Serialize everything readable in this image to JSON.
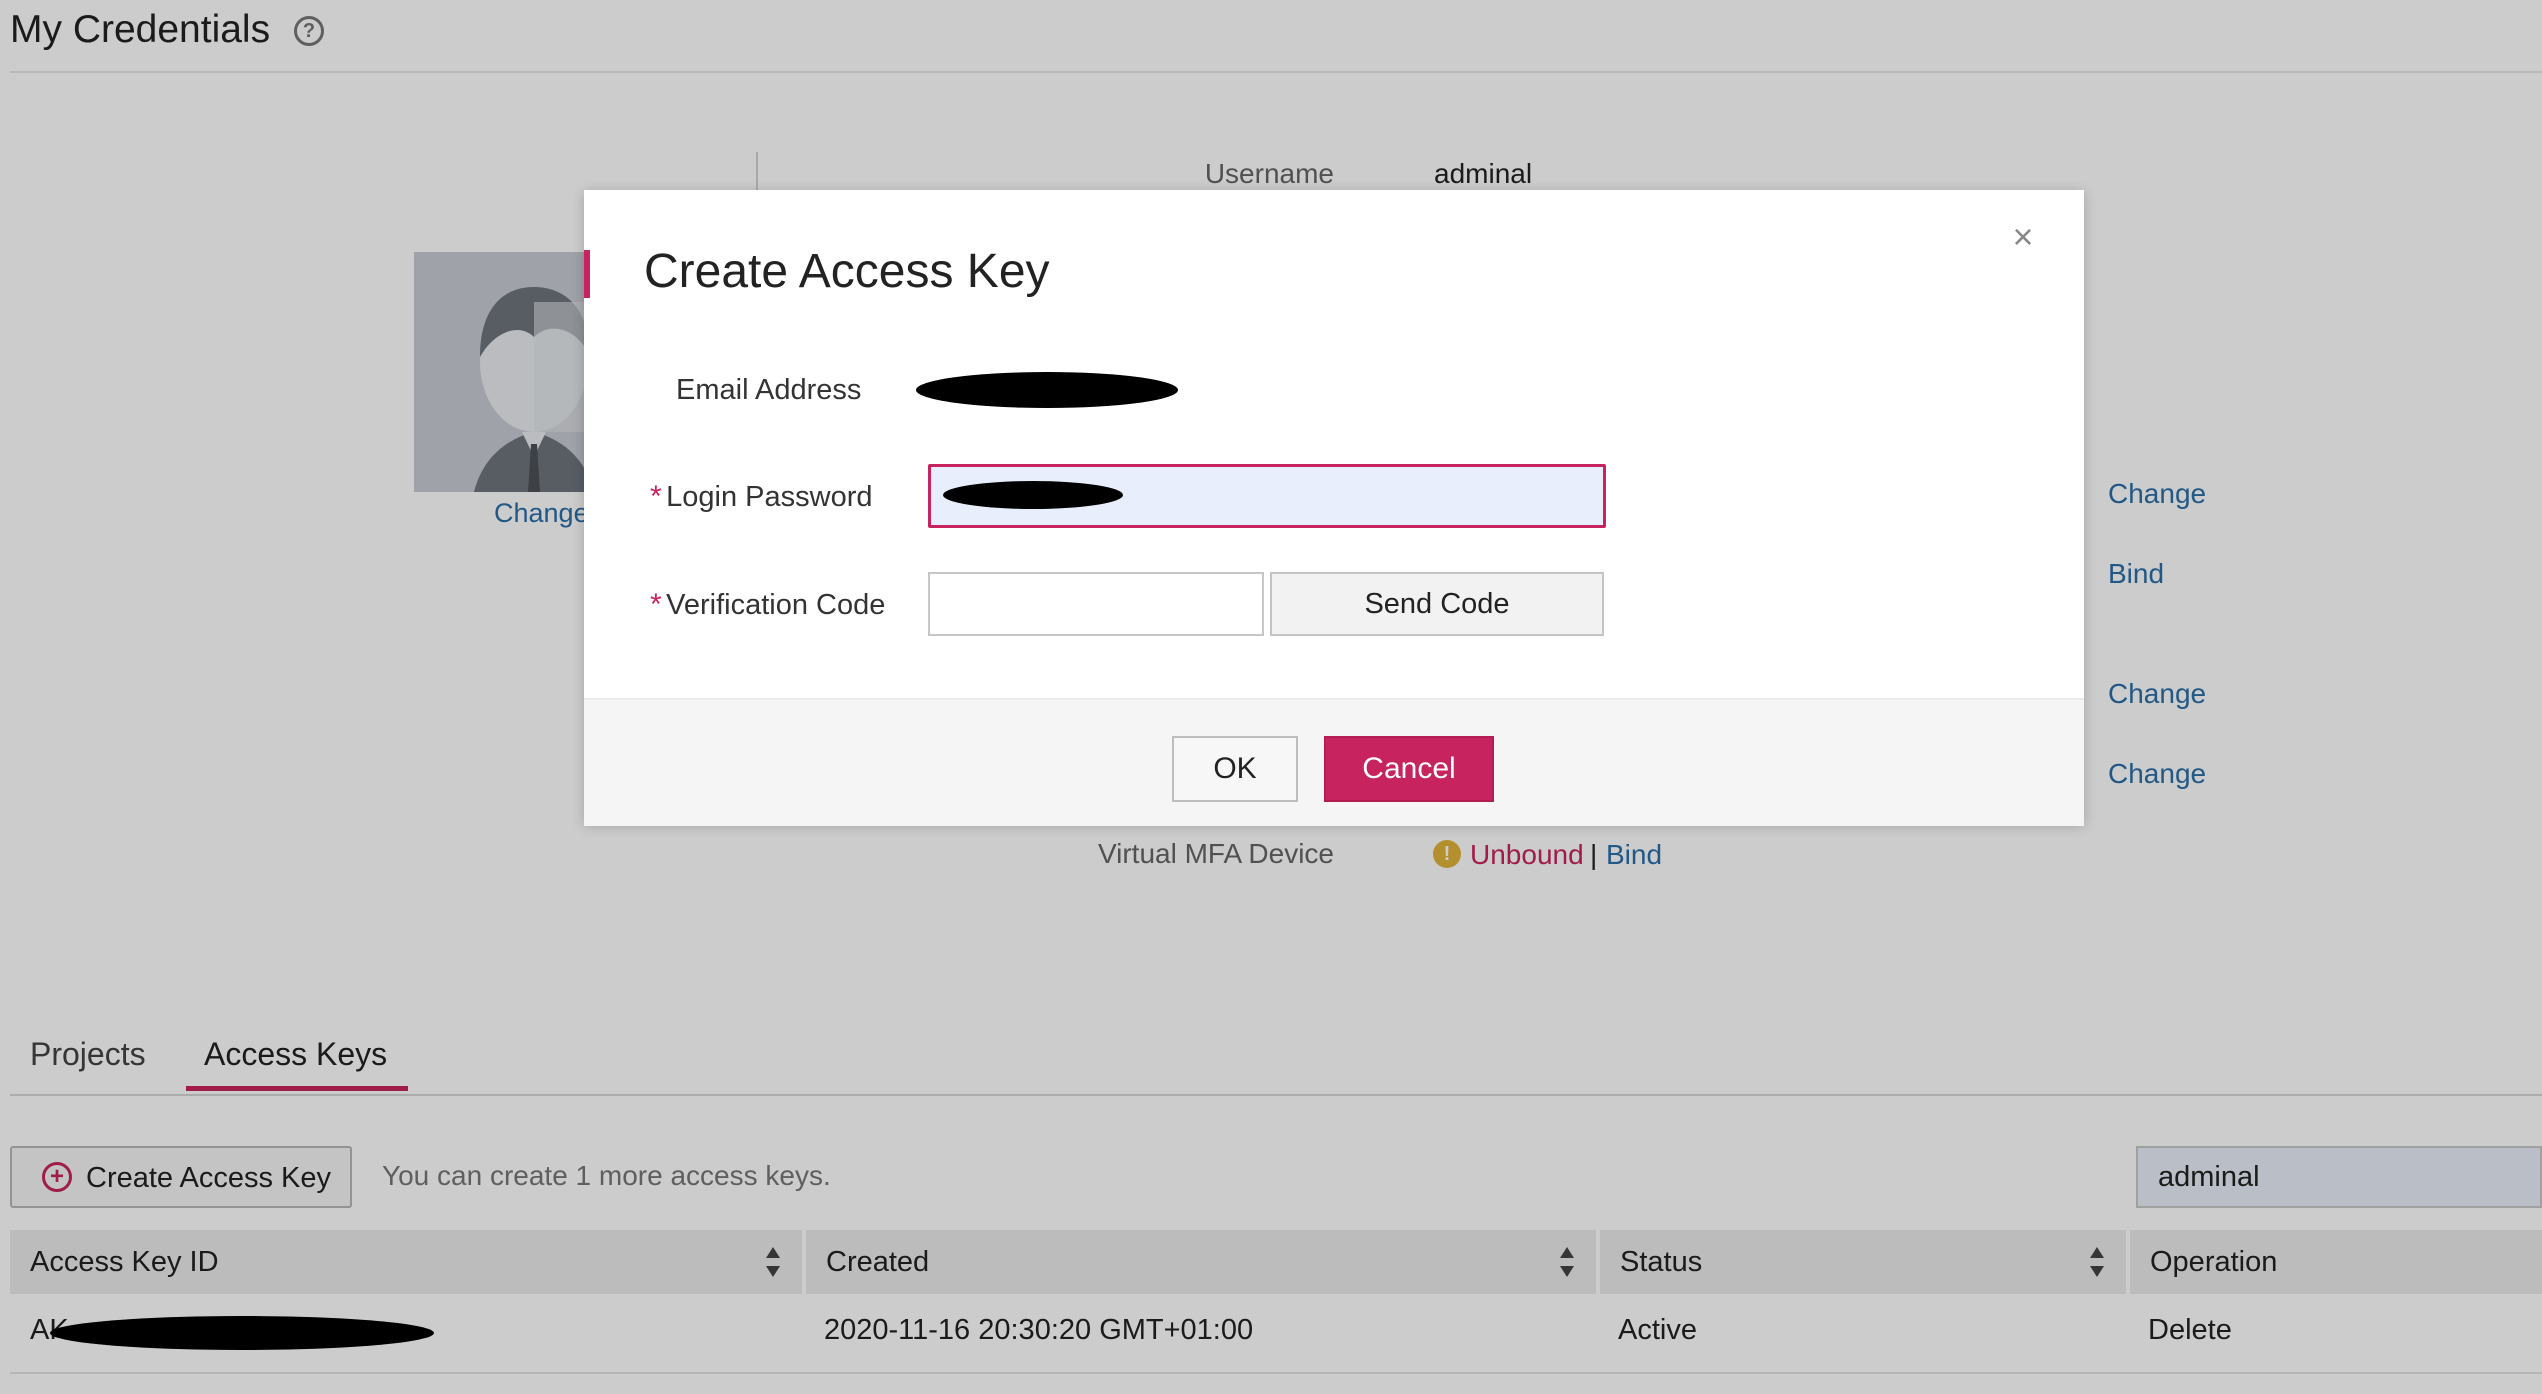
{
  "header": {
    "title": "My Credentials",
    "help_icon": "question-circle-icon"
  },
  "profile": {
    "avatar_change": "Change",
    "fields": {
      "username_label": "Username",
      "username_value": "adminal",
      "mfa_label": "Virtual MFA Device",
      "mfa_status": "Unbound",
      "mfa_separator": "|",
      "mfa_bind": "Bind"
    },
    "right_links": [
      "Change",
      "Bind",
      "Change",
      "Change"
    ]
  },
  "tabs": [
    {
      "label": "Projects",
      "active": false
    },
    {
      "label": "Access Keys",
      "active": true
    }
  ],
  "toolbar": {
    "create_label": "Create Access Key",
    "hint": "You can create 1 more access keys.",
    "search_value": "adminal"
  },
  "table": {
    "columns": [
      "Access Key ID",
      "Created",
      "Status",
      "Operation"
    ],
    "rows": [
      {
        "id_prefix": "AK",
        "created": "2020-11-16 20:30:20 GMT+01:00",
        "status": "Active",
        "operation": "Delete"
      }
    ]
  },
  "modal": {
    "title": "Create Access Key",
    "email_label": "Email Address",
    "password_label": "Login Password",
    "code_label": "Verification Code",
    "required_marker": "*",
    "send_code": "Send Code",
    "ok": "OK",
    "cancel": "Cancel",
    "close_icon": "close-icon"
  },
  "colors": {
    "accent": "#c7235e",
    "link": "#2b6fa8",
    "warning": "#e0b33a"
  }
}
